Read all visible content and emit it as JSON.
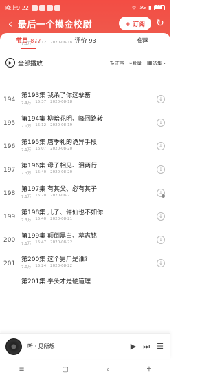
{
  "status": {
    "time": "晚上9:22",
    "network": "5G",
    "battery": "60"
  },
  "header": {
    "title": "最后一个摸金校尉",
    "follow_label": "+ 订阅"
  },
  "tabs": [
    {
      "label": "节目",
      "count": "877",
      "active": true
    },
    {
      "label": "评价",
      "count": "93",
      "active": false
    },
    {
      "label": "推荐",
      "count": "",
      "active": false
    }
  ],
  "toolbar": {
    "play_all": "全部播放",
    "order": "正序",
    "batch": "批量",
    "select": "选集"
  },
  "top_partial": {
    "plays": "7.3万",
    "duration": "15:12",
    "date": "2020-08-18"
  },
  "episodes": [
    {
      "num": "194",
      "title": "第193集 我杀了你这孽畜",
      "plays": "7.3万",
      "duration": "15:37",
      "date": "2020-08-18"
    },
    {
      "num": "195",
      "title": "第194集 柳暗花明、峰回路转",
      "plays": "7.1万",
      "duration": "15:12",
      "date": "2020-08-19"
    },
    {
      "num": "196",
      "title": "第195集 唐季礼的诡异手段",
      "plays": "7.1万",
      "duration": "16:07",
      "date": "2020-08-20"
    },
    {
      "num": "197",
      "title": "第196集 母子相见、泪两行",
      "plays": "7.3万",
      "duration": "15:40",
      "date": "2020-08-20"
    },
    {
      "num": "198",
      "title": "第197集 有其父、必有其子",
      "plays": "7.1万",
      "duration": "15:20",
      "date": "2020-08-21"
    },
    {
      "num": "199",
      "title": "第198集 儿子、许仙也不如你",
      "plays": "7.3万",
      "duration": "15:40",
      "date": "2020-08-21"
    },
    {
      "num": "200",
      "title": "第199集 颠倒黑白、墓志铭",
      "plays": "7.1万",
      "duration": "15:47",
      "date": "2020-08-22"
    },
    {
      "num": "201",
      "title": "第200集 这个男尸是谁?",
      "plays": "7.0万",
      "duration": "15:24",
      "date": "2020-08-22"
    }
  ],
  "next_partial": {
    "title": "第201集 拳头才是硬道理"
  },
  "player": {
    "now_playing": "听 · 见所想"
  }
}
